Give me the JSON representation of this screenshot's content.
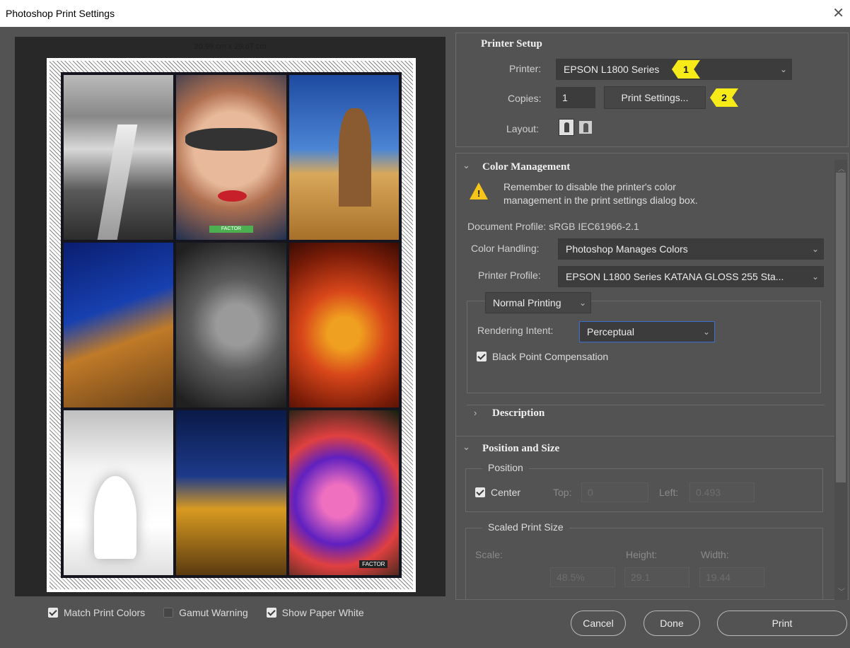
{
  "window": {
    "title": "Photoshop Print Settings",
    "close_glyph": "✕"
  },
  "preview": {
    "paper_size": "20.99 cm x 29.67 cm",
    "badge_a": "FACTOR",
    "badge_b": "FACTOR"
  },
  "preview_options": {
    "match_print_colors": {
      "label": "Match Print Colors",
      "checked": true
    },
    "gamut_warning": {
      "label": "Gamut Warning",
      "checked": false
    },
    "show_paper_white": {
      "label": "Show Paper White",
      "checked": true
    }
  },
  "printer_setup": {
    "title": "Printer Setup",
    "printer_label": "Printer:",
    "printer_value": "EPSON L1800 Series",
    "copies_label": "Copies:",
    "copies_value": "1",
    "print_settings_button": "Print Settings...",
    "layout_label": "Layout:",
    "markers": [
      "1",
      "2"
    ]
  },
  "color_management": {
    "title": "Color Management",
    "warning_line1": "Remember to disable the printer's color",
    "warning_line2": "management in the print settings dialog box.",
    "document_profile": "Document Profile: sRGB IEC61966-2.1",
    "color_handling_label": "Color Handling:",
    "color_handling_value": "Photoshop Manages Colors",
    "printer_profile_label": "Printer Profile:",
    "printer_profile_value": "EPSON L1800 Series KATANA GLOSS 255 Sta...",
    "normal_printing": "Normal Printing",
    "rendering_intent_label": "Rendering Intent:",
    "rendering_intent_value": "Perceptual",
    "black_point_label": "Black Point Compensation"
  },
  "description": {
    "title": "Description"
  },
  "position_size": {
    "title": "Position and Size",
    "position_group": "Position",
    "center_label": "Center",
    "top_label": "Top:",
    "top_value": "0",
    "left_label": "Left:",
    "left_value": "0.493",
    "scaled_group": "Scaled Print Size",
    "scale_label": "Scale:",
    "height_label": "Height:",
    "width_label": "Width:",
    "scale_value": "48.5%",
    "height_value": "29.1",
    "width_value": "19.44"
  },
  "footer": {
    "cancel": "Cancel",
    "done": "Done",
    "print": "Print"
  },
  "icons": [
    "close-icon",
    "warning-icon",
    "portrait-layout-icon",
    "landscape-layout-icon",
    "chevron-down-icon",
    "chevron-right-icon",
    "checkbox-icon"
  ]
}
